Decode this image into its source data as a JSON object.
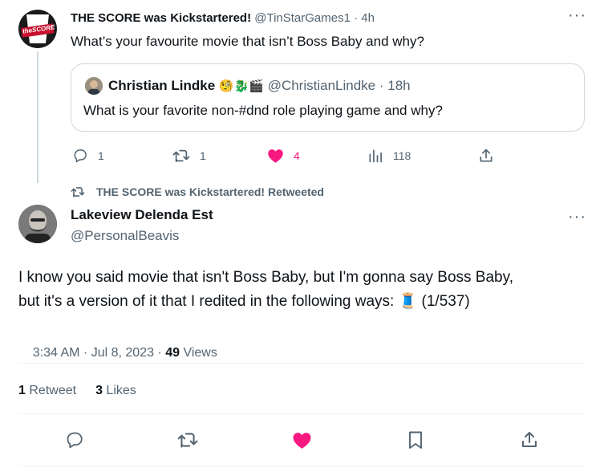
{
  "parent_tweet": {
    "author_name": "THE SCORE was Kickstartered!",
    "handle": "@TinStarGames1",
    "time": "· 4h",
    "text": "What’s your favourite movie that isn’t Boss Baby and why?",
    "quoted": {
      "author_name": "Christian Lindke",
      "author_emojis": "🧐🐉🎬",
      "handle": "@ChristianLindke",
      "time": "· 18h",
      "text": "What is your favorite non-#dnd role playing game and why?"
    },
    "actions": {
      "replies": "1",
      "retweets": "1",
      "likes": "4",
      "views": "118"
    },
    "avatar_logo_text": "theSCORE"
  },
  "retweet_context": {
    "text": "THE SCORE was Kickstartered! Retweeted"
  },
  "main_tweet": {
    "author_name": "Lakeview Delenda Est",
    "handle": "@PersonalBeavis",
    "text_line1": "I know you said movie that isn't Boss Baby, but I'm gonna say Boss Baby,",
    "text_line2": "but it's a version of it that I redited in the following ways: 🧵 (1/537)",
    "timestamp": "3:34 AM · Jul 8, 2023 · ",
    "views_count": "49",
    "views_label": " Views",
    "retweets_count": "1",
    "retweets_label": "Retweet",
    "likes_count": "3",
    "likes_label": "Likes"
  },
  "colors": {
    "text": "#0f1419",
    "muted": "#536471",
    "like_pink": "#f91880",
    "divider": "#eff3f4",
    "border": "#cfd9de"
  },
  "icons": {
    "more": "more-icon",
    "reply": "reply-icon",
    "retweet": "retweet-icon",
    "like": "heart-icon",
    "views": "views-icon",
    "share": "share-icon",
    "bookmark": "bookmark-icon"
  }
}
